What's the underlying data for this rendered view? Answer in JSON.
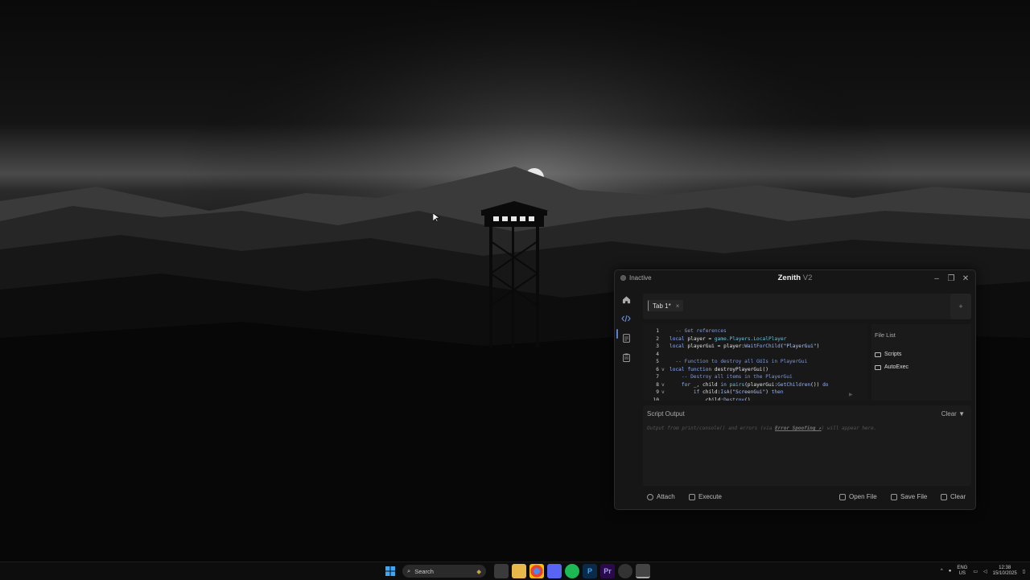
{
  "window": {
    "status": "Inactive",
    "title": "Zenith",
    "version": "V2",
    "minimize": "–",
    "restore": "❐",
    "close": "✕"
  },
  "tabs": [
    {
      "label": "Tab 1*",
      "close": "×"
    }
  ],
  "tab_add": "+",
  "editor": {
    "lines": [
      {
        "n": "1",
        "fold": "",
        "text": "  -- Get references"
      },
      {
        "n": "2",
        "fold": "",
        "text": "local player = game.Players.LocalPlayer"
      },
      {
        "n": "3",
        "fold": "",
        "text": "local playerGui = player:WaitForChild(\"PlayerGui\")"
      },
      {
        "n": "4",
        "fold": "",
        "text": ""
      },
      {
        "n": "5",
        "fold": "",
        "text": "  -- Function to destroy all GUIs in PlayerGui"
      },
      {
        "n": "6",
        "fold": "v",
        "text": "local function destroyPlayerGui()"
      },
      {
        "n": "7",
        "fold": "",
        "text": "    -- Destroy all items in the PlayerGui"
      },
      {
        "n": "8",
        "fold": "v",
        "text": "    for _, child in pairs(playerGui:GetChildren()) do"
      },
      {
        "n": "9",
        "fold": "v",
        "text": "        if child:IsA(\"ScreenGui\") then"
      },
      {
        "n": "10",
        "fold": "",
        "text": "            child:Destroy()"
      }
    ],
    "run_hint": "▶"
  },
  "file_list": {
    "title": "File List",
    "items": [
      "Scripts",
      "AutoExec"
    ]
  },
  "output": {
    "title": "Script Output",
    "clear": "Clear",
    "placeholder_pre": "Output from print/console() and errors (via ",
    "placeholder_link": "Error Spoofing ↗",
    "placeholder_post": ") will appear here."
  },
  "footer": {
    "attach": "Attach",
    "execute": "Execute",
    "open_file": "Open File",
    "save_file": "Save File",
    "clear": "Clear"
  },
  "taskbar": {
    "search": "Search",
    "lang_top": "ENG",
    "lang_bottom": "US",
    "time": "12:38",
    "date": "15/10/2025",
    "apps": [
      "P",
      "Pr"
    ]
  },
  "colors": {
    "accent": "#5b7fd0",
    "window_bg": "#161616"
  }
}
